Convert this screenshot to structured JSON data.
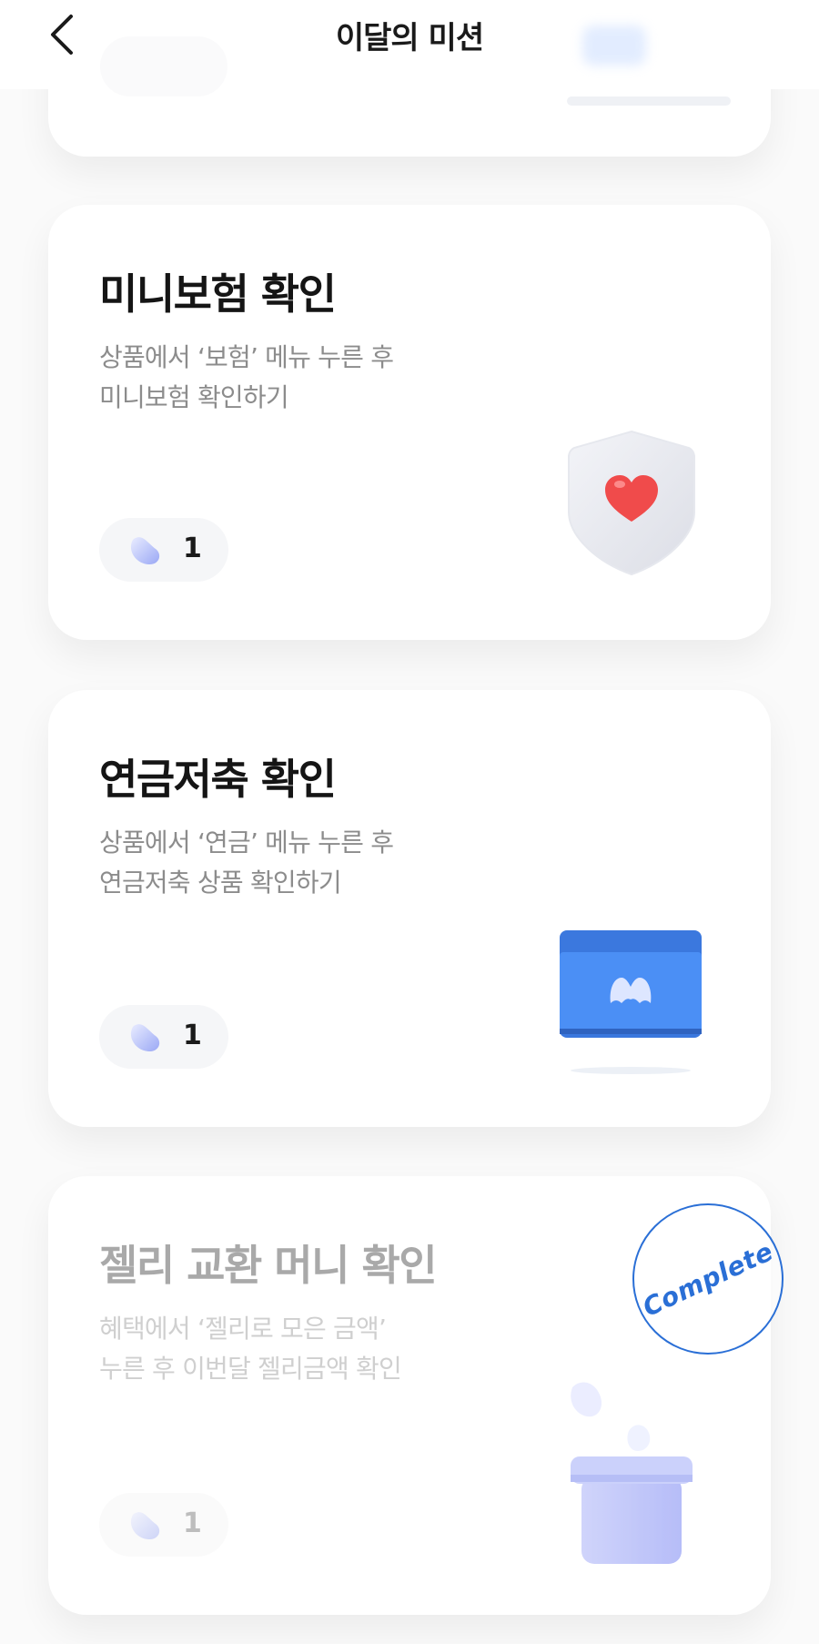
{
  "header": {
    "title": "이달의 미션",
    "back_icon": "chevron-left-icon"
  },
  "missions": [
    {
      "title": "미니보험 확인",
      "desc_line1": "상품에서 ‘보험’ 메뉴 누른 후",
      "desc_line2": "미니보험 확인하기",
      "reward": "1",
      "icon": "shield-heart-icon",
      "completed": false
    },
    {
      "title": "연금저축 확인",
      "desc_line1": "상품에서 ‘연금’ 메뉴 누른 후",
      "desc_line2": "연금저축 상품 확인하기",
      "reward": "1",
      "icon": "pension-book-icon",
      "completed": false
    },
    {
      "title": "젤리 교환 머니 확인",
      "desc_line1": "혜택에서 ‘젤리로 모은 금액’",
      "desc_line2": "누른 후 이번달 젤리금액 확인",
      "reward": "1",
      "icon": "jelly-jar-icon",
      "completed": true,
      "stamp": "Complete"
    }
  ],
  "colors": {
    "accent_blue": "#2a6fd6",
    "book_blue": "#4b8ff5",
    "heart_red": "#f04b4b",
    "jar_lavender": "#b6bdfa"
  }
}
